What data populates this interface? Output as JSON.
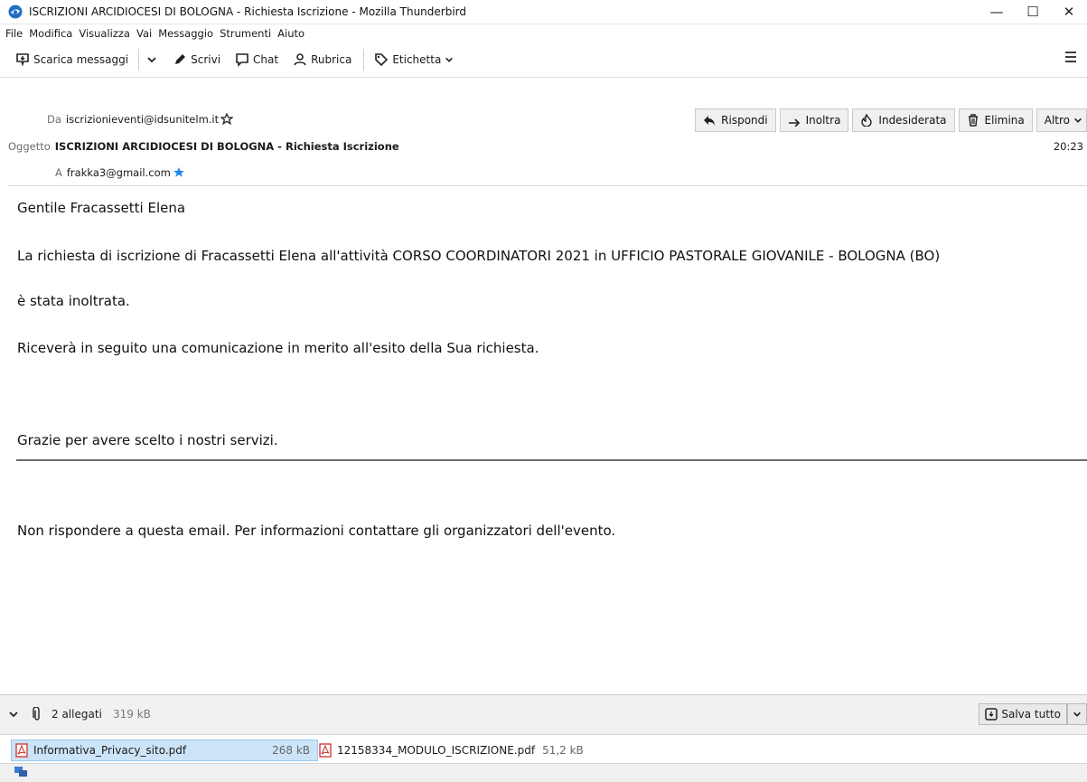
{
  "window": {
    "title": "ISCRIZIONI ARCIDIOCESI DI BOLOGNA - Richiesta Iscrizione - Mozilla Thunderbird",
    "minimize": "—",
    "maximize": "☐",
    "close": "✕"
  },
  "menu": {
    "items": [
      "File",
      "Modifica",
      "Visualizza",
      "Vai",
      "Messaggio",
      "Strumenti",
      "Aiuto"
    ]
  },
  "toolbar": {
    "get_messages": "Scarica messaggi",
    "write": "Scrivi",
    "chat": "Chat",
    "address_book": "Rubrica",
    "tag": "Etichetta"
  },
  "header": {
    "from_label": "Da",
    "from_value": "iscrizionieventi@idsunitelm.it",
    "subject_label": "Oggetto",
    "subject_value": "ISCRIZIONI ARCIDIOCESI DI BOLOGNA - Richiesta Iscrizione",
    "to_label": "A",
    "to_value": "frakka3@gmail.com",
    "time": "20:23",
    "actions": {
      "reply": "Rispondi",
      "forward": "Inoltra",
      "junk": "Indesiderata",
      "delete": "Elimina",
      "other": "Altro"
    }
  },
  "message": {
    "greeting": "Gentile Fracassetti Elena",
    "line1": "La richiesta di iscrizione di Fracassetti Elena all'attività CORSO COORDINATORI 2021 in UFFICIO PASTORALE GIOVANILE - BOLOGNA (BO)",
    "line2": "è stata inoltrata.",
    "line3": "Riceverà in seguito una comunicazione in merito all'esito della Sua richiesta.",
    "line4": "Grazie per avere scelto i nostri servizi.",
    "line5": "Non rispondere a questa email. Per informazioni contattare gli organizzatori dell'evento."
  },
  "attachments": {
    "summary": "2 allegati",
    "total_size": "319 kB",
    "save_all": "Salva tutto",
    "files": [
      {
        "name": "Informativa_Privacy_sito.pdf",
        "size": "268 kB"
      },
      {
        "name": "12158334_MODULO_ISCRIZIONE.pdf",
        "size": "51,2 kB"
      }
    ]
  },
  "colors": {
    "accent": "#0060df",
    "pdf_red": "#d0312d",
    "selected_attachment": "#cce4f7"
  }
}
